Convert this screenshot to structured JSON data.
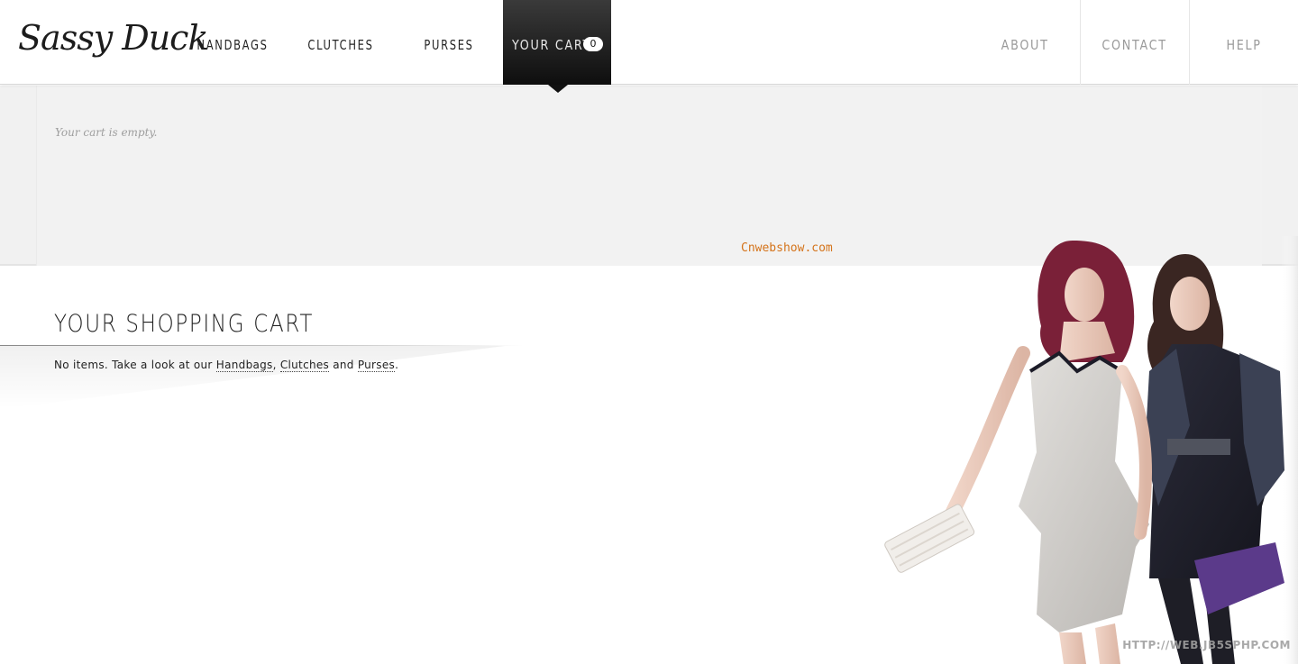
{
  "brand": {
    "logo_text": "Sassy Duck"
  },
  "nav": {
    "left": [
      {
        "label": "HANDBAGS"
      },
      {
        "label": "CLUTCHES"
      },
      {
        "label": "PURSES"
      }
    ],
    "cart": {
      "label": "YOUR CART",
      "count": "0"
    },
    "right": [
      {
        "label": "ABOUT"
      },
      {
        "label": "CONTACT"
      },
      {
        "label": "HELP"
      }
    ]
  },
  "cart_panel": {
    "empty_text": "Your cart is empty.",
    "watermark": "Cnwebshow.com"
  },
  "main": {
    "title": "YOUR SHOPPING CART",
    "message_prefix": "No items. Take a look at our ",
    "link_handbags": "Handbags",
    "sep1": ", ",
    "link_clutches": "Clutches",
    "sep2": " and ",
    "link_purses": "Purses",
    "suffix": "."
  },
  "footer": {
    "watermark": "HTTP://WEB.JB5SPHP.COM"
  },
  "colors": {
    "accent_dark": "#111111",
    "watermark_orange": "#d4731a",
    "nav_muted": "#9a9a9a"
  }
}
